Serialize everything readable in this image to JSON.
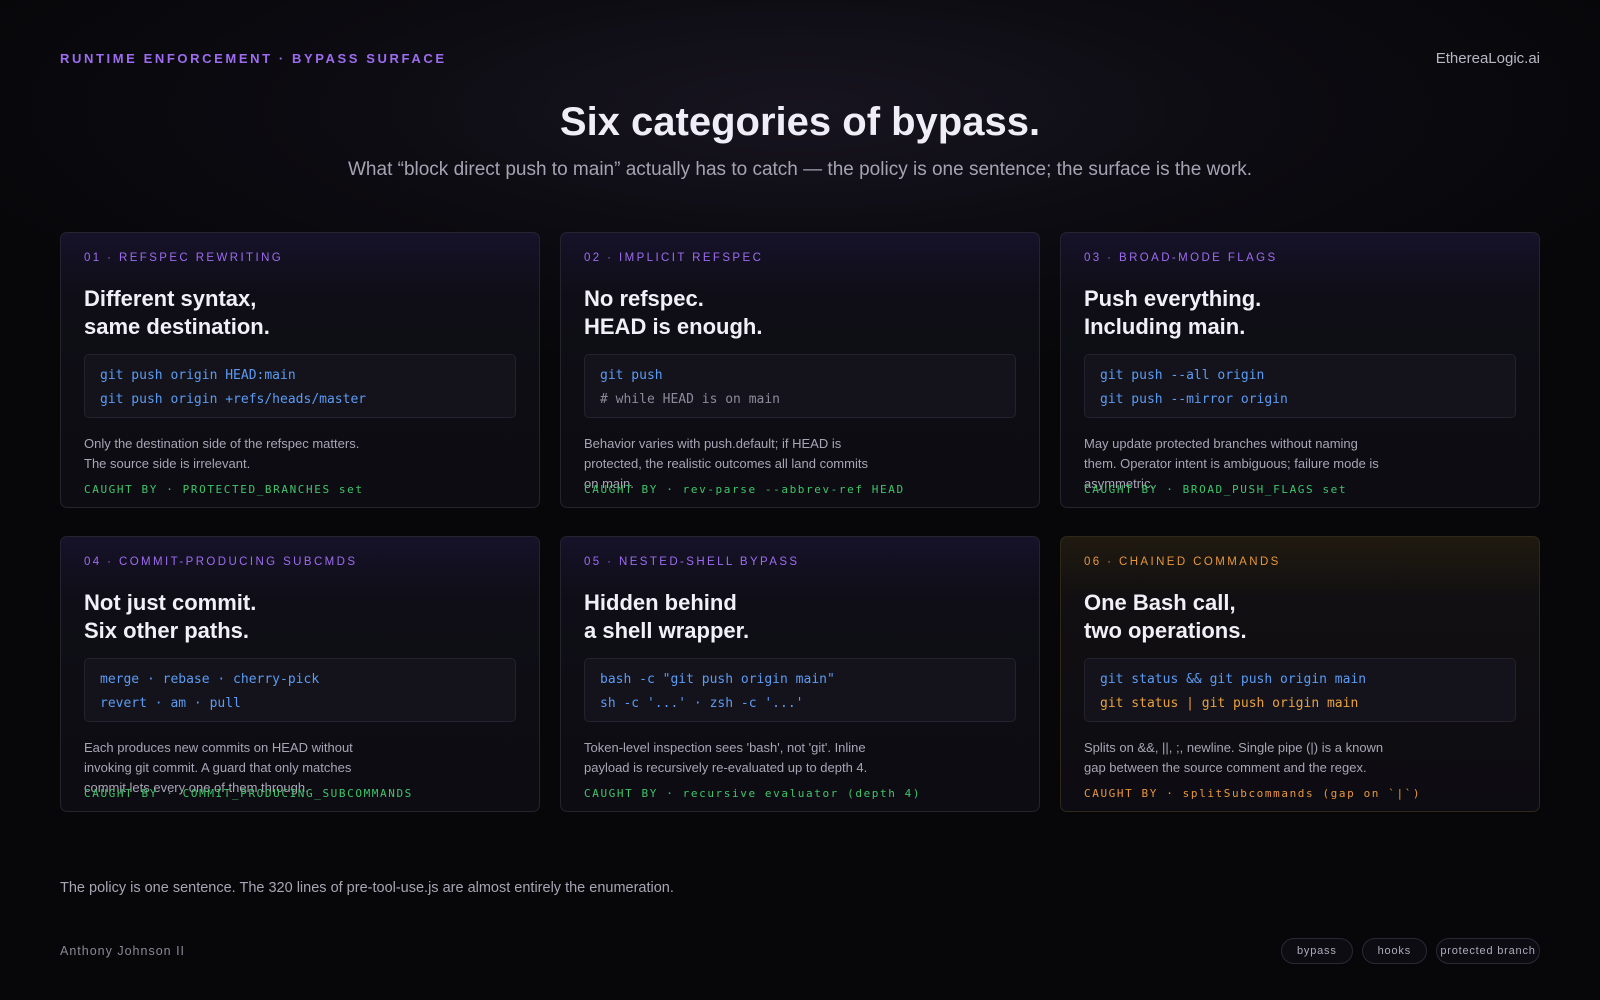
{
  "header": {
    "eyebrow": "RUNTIME ENFORCEMENT · BYPASS SURFACE",
    "brand": "EthereaLogic.ai",
    "title": "Six categories of bypass.",
    "subtitle": "What “block direct push to main” actually has to catch — the policy is one sentence; the surface is the work."
  },
  "cards": [
    {
      "tag": "01 · REFSPEC REWRITING",
      "head1": "Different syntax,",
      "head2": "same destination.",
      "code1": "git push origin HEAD:main",
      "code2": "git push origin +refs/heads/master",
      "desc": "Only the destination side of the refspec matters. The source side is irrelevant.",
      "caught": "CAUGHT BY · PROTECTED_BRANCHES set"
    },
    {
      "tag": "02 · IMPLICIT REFSPEC",
      "head1": "No refspec.",
      "head2": "HEAD is enough.",
      "code1": "git push",
      "code2": "# while HEAD is on main",
      "desc": "Behavior varies with push.default; if HEAD is protected, the realistic outcomes all land commits on main.",
      "caught": "CAUGHT BY · rev-parse --abbrev-ref HEAD"
    },
    {
      "tag": "03 · BROAD-MODE FLAGS",
      "head1": "Push everything.",
      "head2": "Including main.",
      "code1": "git push --all origin",
      "code2": "git push --mirror origin",
      "desc": "May update protected branches without naming them. Operator intent is ambiguous; failure mode is asymmetric.",
      "caught": "CAUGHT BY · BROAD_PUSH_FLAGS set"
    },
    {
      "tag": "04 · COMMIT-PRODUCING SUBCMDS",
      "head1": "Not just commit.",
      "head2": "Six other paths.",
      "code1": "merge · rebase · cherry-pick",
      "code2": "revert · am · pull",
      "desc": "Each produces new commits on HEAD without invoking git commit. A guard that only matches commit lets every one of them through.",
      "caught": "CAUGHT BY · COMMIT_PRODUCING_SUBCOMMANDS"
    },
    {
      "tag": "05 · NESTED-SHELL BYPASS",
      "head1": "Hidden behind",
      "head2": "a shell wrapper.",
      "code1": "bash -c \"git push origin main\"",
      "code2": "sh -c '...' · zsh -c '...'",
      "desc": "Token-level inspection sees 'bash', not 'git'. Inline payload is recursively re-evaluated up to depth 4.",
      "caught": "CAUGHT BY · recursive evaluator (depth 4)"
    },
    {
      "tag": "06 · CHAINED COMMANDS",
      "head1": "One Bash call,",
      "head2": "two operations.",
      "code1": "git status && git push origin main",
      "code2": "git status | git push origin main",
      "desc": "Splits on &&, ||, ;, newline. Single pipe (|) is a known gap between the source comment and the regex.",
      "caught": "CAUGHT BY · splitSubcommands (gap on `|`)"
    }
  ],
  "footer": {
    "note": "The policy is one sentence. The 320 lines of pre-tool-use.js are almost entirely the enumeration.",
    "author": "Anthony Johnson II",
    "tags": [
      "bypass",
      "hooks",
      "protected branch"
    ]
  },
  "colors": {
    "accent": "#9d6cf0",
    "code": "#5b9bf2",
    "caught": "#3ec56b",
    "warning": "#e8963c"
  }
}
